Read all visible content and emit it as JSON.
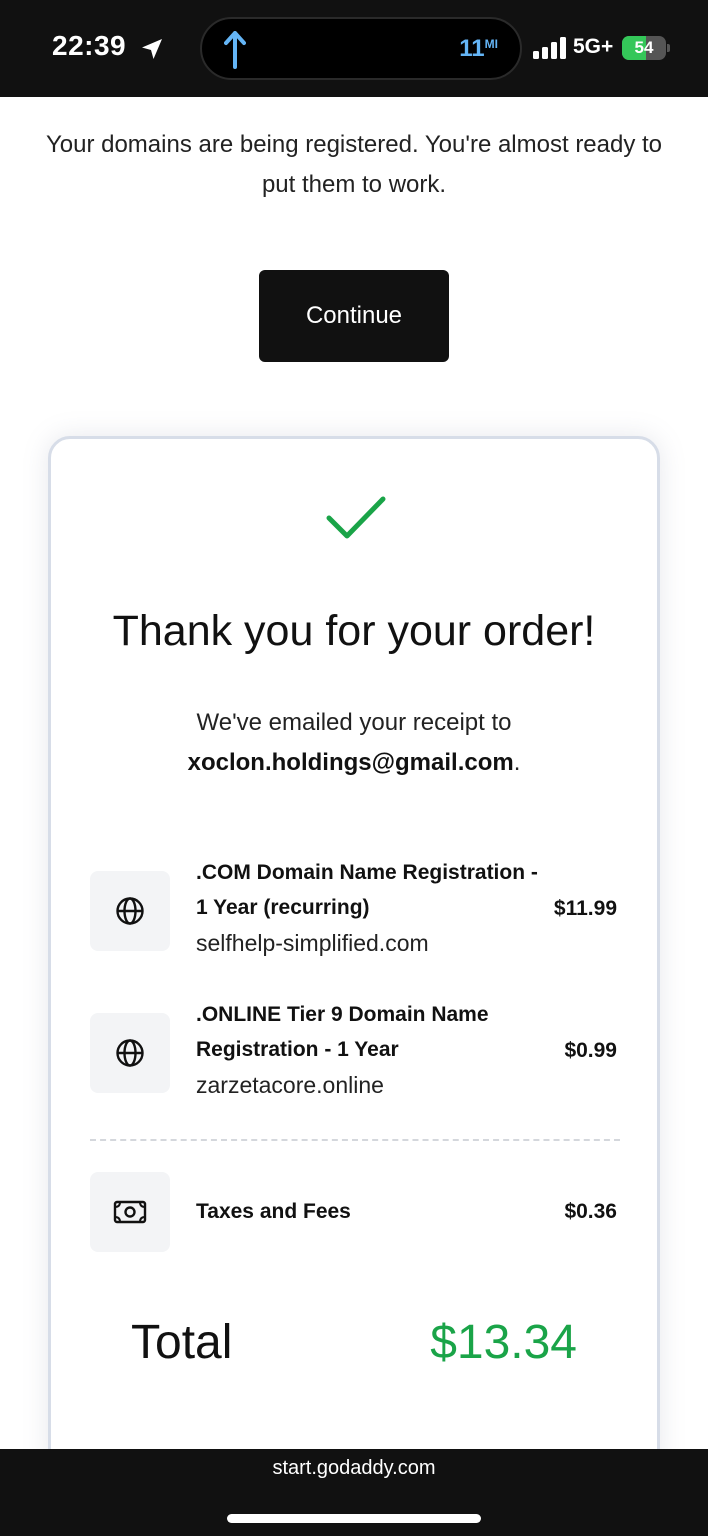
{
  "status_bar": {
    "time": "22:39",
    "distance": "11",
    "distance_unit": "MI",
    "network": "5G+",
    "battery_level": "54",
    "battery_fraction": 0.54,
    "icons": [
      "location-arrow-icon",
      "navigation-up-arrow-icon",
      "signal-bars-icon",
      "battery-charging-icon"
    ]
  },
  "intro": {
    "message_line1": "Your domains are being registered. You're almost ready to",
    "message_line2": "put them to work.",
    "continue_label": "Continue"
  },
  "card": {
    "title": "Thank you for your order!",
    "receipt_text": "We've emailed your receipt to",
    "email": "xoclon.holdings@gmail.com",
    "email_suffix": ".",
    "items": [
      {
        "icon": "globe-icon",
        "title_line1": ".COM Domain Name Registration -",
        "title_line2": "1 Year (recurring)",
        "domain": "selfhelp-simplified.com",
        "price": "$11.99"
      },
      {
        "icon": "globe-icon",
        "title_line1": ".ONLINE Tier 9 Domain Name",
        "title_line2": "Registration - 1 Year",
        "domain": "zarzetacore.online",
        "price": "$0.99"
      }
    ],
    "fees": {
      "icon": "cash-icon",
      "label": "Taxes and Fees",
      "price": "$0.36"
    },
    "total_label": "Total",
    "total_value": "$13.34"
  },
  "browser": {
    "url": "start.godaddy.com"
  },
  "colors": {
    "accent_green": "#1aa448",
    "button_dark": "#111111",
    "battery_green": "#34c759",
    "nav_blue": "#64b5f6"
  }
}
